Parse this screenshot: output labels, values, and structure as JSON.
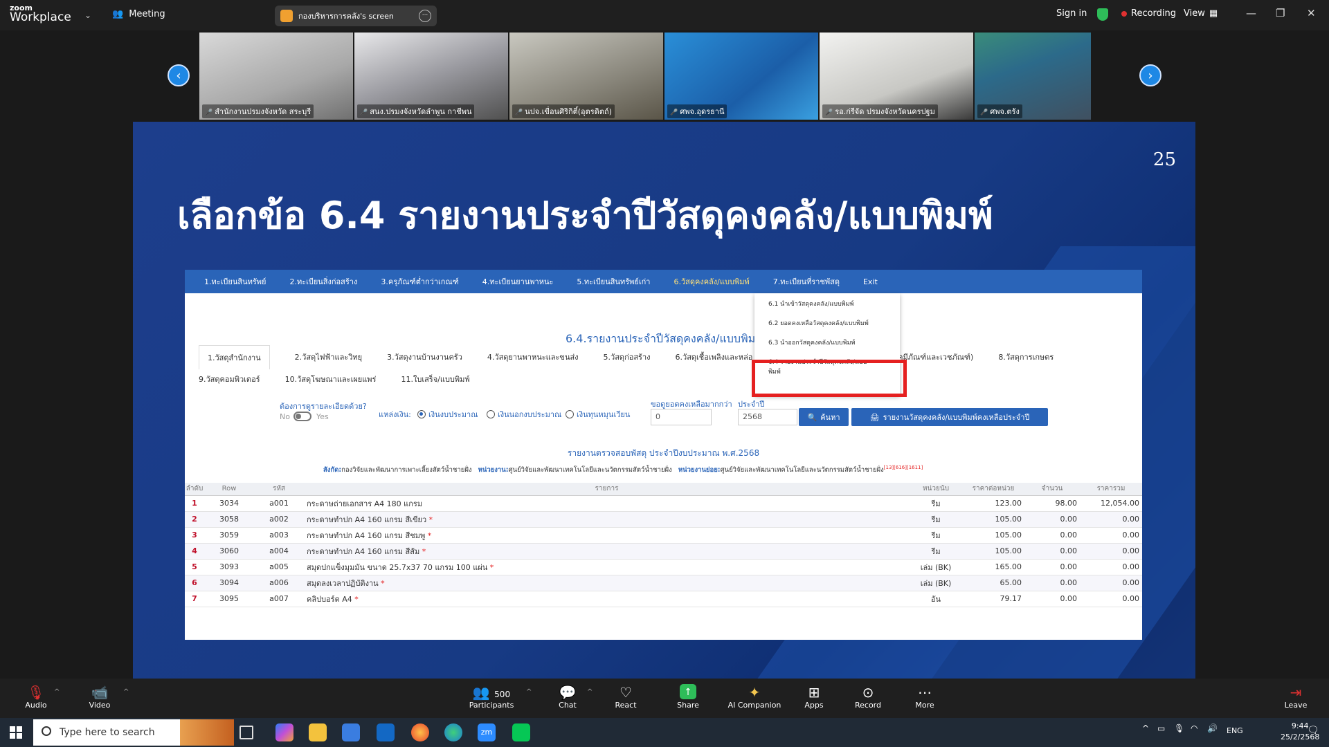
{
  "topbar": {
    "logo_small": "zoom",
    "logo_big": "Workplace",
    "meeting": "Meeting",
    "share_chip": "กองบริหารการคลัง's screen",
    "sign_in": "Sign in",
    "recording": "Recording",
    "view": "View"
  },
  "participants_strip": [
    "สำนักงานปรมงจังหวัด สระบุรี",
    "สนง.ปรมงจังหวัดลำพูน กาชีพน",
    "นปจ.เขื่อนศิริกิติ์(อุตรดิตถ์)",
    "ศพจ.อุดรธานี",
    "รอ.ก่รีจัด ปรมงจังหวัดนครปฐม",
    "ศพจ.ตรัง"
  ],
  "slide": {
    "number": "25",
    "title": "เลือกข้อ 6.4 รายงานประจำปีวัสดุคงคลัง/แบบพิมพ์"
  },
  "web": {
    "menu": [
      "1.ทะเบียนสินทรัพย์",
      "2.ทะเบียนสิ่งก่อสร้าง",
      "3.ครุภัณฑ์ต่ำกว่าเกณฑ์",
      "4.ทะเบียนยานพาหนะ",
      "5.ทะเบียนสินทรัพย์เก่า",
      "6.วัสดุคงคลัง/แบบพิมพ์",
      "7.ทะเบียนที่ราชพัสดุ",
      "Exit"
    ],
    "dropdown": [
      "6.1 นำเข้าวัสดุคงคลัง/แบบพิมพ์",
      "6.2 ยอดคงเหลือวัสดุคงคลัง/แบบพิมพ์",
      "6.3 นำออกวัสดุคงคลัง/แบบพิมพ์",
      "6.4 รายงานประจำปีวัสดุคงคลัง/แบบพิมพ์"
    ],
    "report_title": "6.4.รายงานประจำปีวัสดุคงคลัง/แบบพิมพ์",
    "tabs_row1": [
      "1.วัสดุสำนักงาน",
      "2.วัสดุไฟฟ้าและวิทยุ",
      "3.วัสดุงานบ้านงานครัว",
      "4.วัสดุยานพาหนะและขนส่ง",
      "5.วัสดุก่อสร้าง",
      "6.วัสดุเชื้อเพลิงและหล่อ",
      "เคมีภัณฑ์และเวชภัณฑ์)",
      "8.วัสดุการเกษตร"
    ],
    "tabs_row2": [
      "9.วัสดุคอมพิวเตอร์",
      "10.วัสดุโฆษณาและเผยแพร่",
      "11.ใบเสร็จ/แบบพิมพ์"
    ],
    "filters": {
      "detail_q": "ต้องการดูรายละเอียดด้วย?",
      "no": "No",
      "yes": "Yes",
      "source_label": "แหล่งเงิน:",
      "source_opts": [
        "เงินงบประมาณ",
        "เงินนอกงบประมาณ",
        "เงินทุนหมุนเวียน"
      ],
      "min_label": "ขอดูยอดคงเหลือมากกว่า",
      "min_value": "0",
      "year_label": "ประจำปี",
      "year_value": "2568",
      "search_btn": "ค้นหา",
      "print_btn": "รายงานวัสดุคงคลัง/แบบพิมพ์คงเหลือประจำปี"
    },
    "inspection": "รายงานตรวจสอบพัสดุ ประจำปีงบประมาณ พ.ศ.2568",
    "org": {
      "k1": "สังกัด:",
      "v1": "กองวิจัยและพัฒนาการเพาะเลี้ยงสัตว์น้ำชายฝั่ง",
      "k2": "หน่วยงาน:",
      "v2": "ศูนย์วิจัยและพัฒนาเทคโนโลยีและนวัตกรรมสัตว์น้ำชายฝั่ง",
      "k3": "หน่วยงานย่อย:",
      "v3": "ศูนย์วิจัยและพัฒนาเทคโนโลยีและนวัตกรรมสัตว์น้ำชายฝั่ง",
      "code": "[13][616][1611]"
    },
    "table": {
      "headers": [
        "ลำดับ",
        "Row",
        "รหัส",
        "รายการ",
        "หน่วยนับ",
        "ราคาต่อหน่วย",
        "จำนวน",
        "ราคารวม"
      ],
      "rows": [
        [
          "1",
          "3034",
          "a001",
          "กระดาษถ่ายเอกสาร A4 180 แกรม",
          "รีม",
          "123.00",
          "98.00",
          "12,054.00"
        ],
        [
          "2",
          "3058",
          "a002",
          "กระดาษทำปก A4 160 แกรม สีเขียว",
          "รีม",
          "105.00",
          "0.00",
          "0.00"
        ],
        [
          "3",
          "3059",
          "a003",
          "กระดาษทำปก A4 160 แกรม สีชมพู",
          "รีม",
          "105.00",
          "0.00",
          "0.00"
        ],
        [
          "4",
          "3060",
          "a004",
          "กระดาษทำปก A4 160 แกรม สีส้ม",
          "รีม",
          "105.00",
          "0.00",
          "0.00"
        ],
        [
          "5",
          "3093",
          "a005",
          "สมุดปกแข็งมุมมัน ขนาด 25.7x37 70 แกรม 100 แผ่น",
          "เล่ม (BK)",
          "165.00",
          "0.00",
          "0.00"
        ],
        [
          "6",
          "3094",
          "a006",
          "สมุดลงเวลาปฏิบัติงาน",
          "เล่ม (BK)",
          "65.00",
          "0.00",
          "0.00"
        ],
        [
          "7",
          "3095",
          "a007",
          "คลิปบอร์ด A4",
          "อัน",
          "79.17",
          "0.00",
          "0.00"
        ]
      ],
      "starred": [
        false,
        true,
        true,
        true,
        true,
        true,
        true
      ]
    }
  },
  "bottombar": {
    "audio": "Audio",
    "video": "Video",
    "participants_count": "500",
    "participants": "Participants",
    "chat": "Chat",
    "react": "React",
    "share": "Share",
    "ai": "AI Companion",
    "apps": "Apps",
    "record": "Record",
    "more": "More",
    "leave": "Leave"
  },
  "taskbar": {
    "search_placeholder": "Type here to search",
    "lang": "ENG",
    "time": "9:44",
    "date": "25/2/2568"
  }
}
